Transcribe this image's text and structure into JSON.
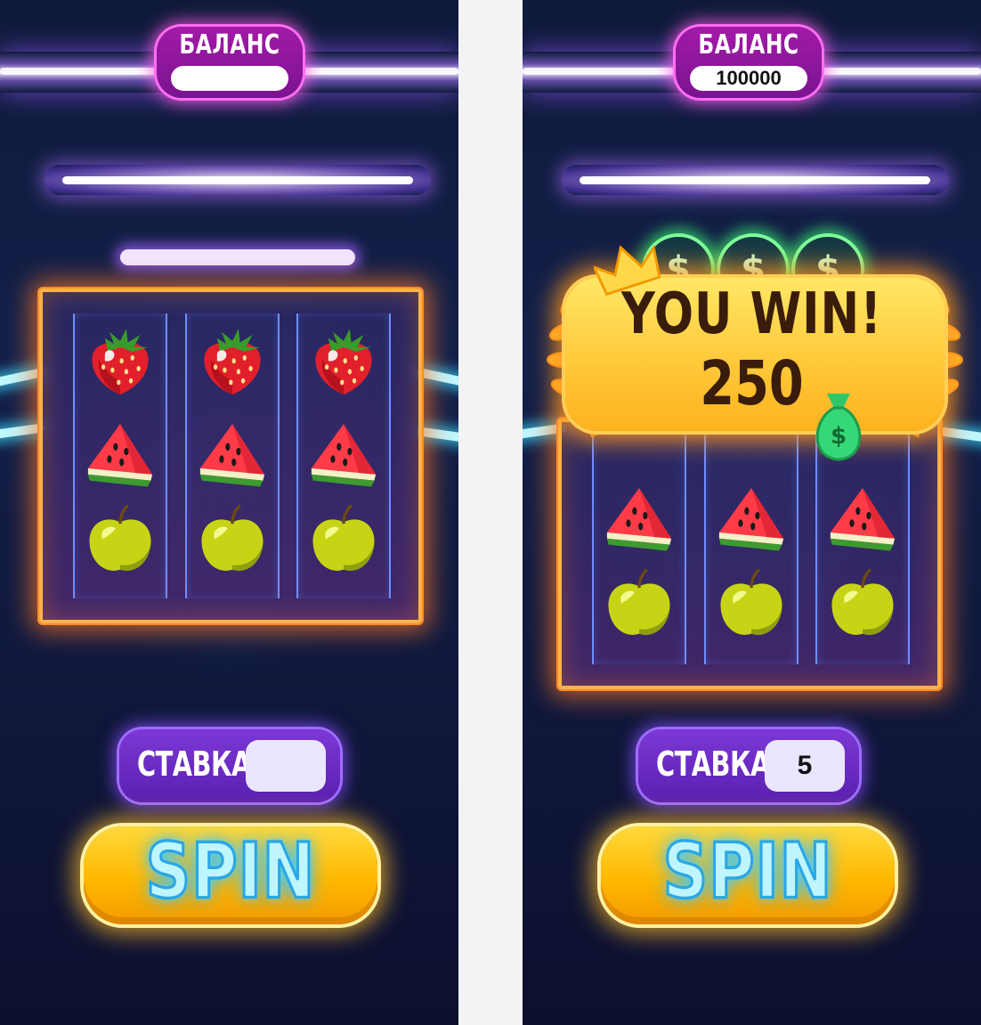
{
  "screens": [
    {
      "id": "left",
      "balance": {
        "label": "БАЛАНС",
        "value": ""
      },
      "stake": {
        "label": "СТАВКА",
        "value": ""
      },
      "spin_label": "SPIN",
      "reels": [
        [
          "strawberry-icon",
          "watermelon-icon",
          "apple-icon"
        ],
        [
          "strawberry-icon",
          "watermelon-icon",
          "apple-icon"
        ],
        [
          "strawberry-icon",
          "watermelon-icon",
          "apple-icon"
        ]
      ]
    },
    {
      "id": "right",
      "balance": {
        "label": "БАЛАНС",
        "value": "100000"
      },
      "stake": {
        "label": "СТАВКА",
        "value": "5"
      },
      "spin_label": "SPIN",
      "win": {
        "title": "YOU WIN!",
        "amount": "250",
        "coin_symbol": "$"
      },
      "reels": [
        [
          "watermelon-icon",
          "apple-icon"
        ],
        [
          "watermelon-icon",
          "apple-icon"
        ],
        [
          "watermelon-icon",
          "apple-icon"
        ]
      ]
    }
  ],
  "colors": {
    "background": "#0f1a3a",
    "neon_purple": "#a21aa8",
    "frame_orange": "#ffb347",
    "spin_yellow": "#ffc61e",
    "spin_text": "#bff5ff",
    "win_gold": "#ffd24a"
  }
}
